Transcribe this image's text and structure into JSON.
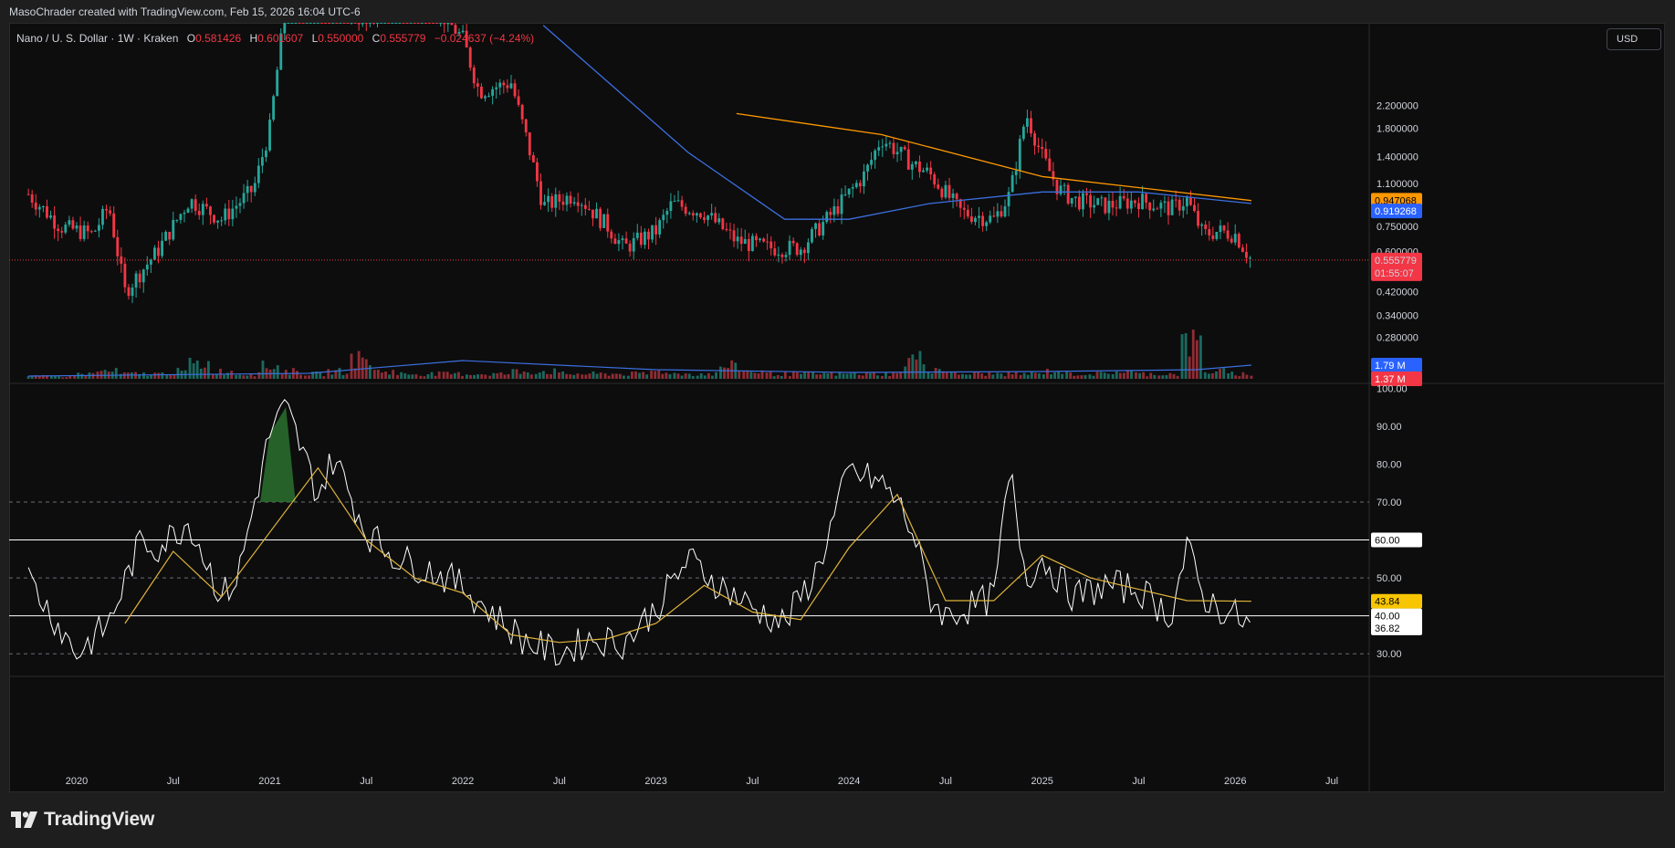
{
  "credit": "MasoChrader created with TradingView.com, Feb 15, 2026 16:04 UTC-6",
  "header": {
    "symbol": "Nano / U. S. Dollar · 1W · Kraken",
    "o_label": "O",
    "o_value": "0.581426",
    "h_label": "H",
    "h_value": "0.601607",
    "l_label": "L",
    "l_value": "0.550000",
    "c_label": "C",
    "c_value": "0.555779",
    "change": "−0.024637 (−4.24%)"
  },
  "currency_button": "USD",
  "brand": "TradingView",
  "colors": {
    "up": "#26a69a",
    "down": "#f23645",
    "ma_fast": "#3b6fe0",
    "ma_slow": "#ff9800",
    "rsi": "#ffffff",
    "rsi_ma": "#e0b43b",
    "overbought_fill": "#2e7d32"
  },
  "chart_data": [
    {
      "type": "candlestick",
      "pane": "price",
      "yscale": "log",
      "price_ticks": [
        "2.200000",
        "1.800000",
        "1.400000",
        "1.100000",
        "0.750000",
        "0.600000",
        "0.420000",
        "0.340000",
        "0.280000"
      ],
      "time_ticks": [
        "2020",
        "Jul",
        "2021",
        "Jul",
        "2022",
        "Jul",
        "2023",
        "Jul",
        "2024",
        "Jul",
        "2025",
        "Jul",
        "2026",
        "Jul"
      ],
      "labels": {
        "ma_slow_value": "0.947068",
        "ma_fast_value": "0.919268",
        "last_price": "0.555779",
        "countdown": "01:55:07",
        "volume_ma": "1.79 M",
        "volume_last": "1.37 M"
      },
      "ma_slow_line": {
        "x": [
          "2023-06",
          "2024-03",
          "2025-01",
          "2026-02"
        ],
        "y": [
          2.05,
          1.7,
          1.17,
          0.945
        ]
      },
      "ma_fast_line": {
        "x": [
          "2022-06",
          "2023-03",
          "2023-09",
          "2024-01",
          "2024-06",
          "2025-01",
          "2025-07",
          "2026-02"
        ],
        "y": [
          4.5,
          1.45,
          0.8,
          0.8,
          0.92,
          1.02,
          1.02,
          0.92
        ]
      },
      "close_anchors": {
        "x": [
          "2019-10",
          "2019-12",
          "2020-02",
          "2020-03",
          "2020-04",
          "2020-06",
          "2020-08",
          "2020-10",
          "2020-12",
          "2021-01",
          "2021-02",
          "2021-04",
          "2021-05",
          "2021-07",
          "2021-09",
          "2021-11",
          "2022-01",
          "2022-02",
          "2022-04",
          "2022-05",
          "2022-06",
          "2022-08",
          "2022-10",
          "2022-11",
          "2023-01",
          "2023-02",
          "2023-04",
          "2023-06",
          "2023-08",
          "2023-10",
          "2023-12",
          "2024-02",
          "2024-03",
          "2024-05",
          "2024-06",
          "2024-08",
          "2024-10",
          "2024-11",
          "2024-12",
          "2025-01",
          "2025-02",
          "2025-03",
          "2025-05",
          "2025-07",
          "2025-09",
          "2025-10",
          "2025-11",
          "2025-12",
          "2026-01",
          "2026-02"
        ],
        "y": [
          1.0,
          0.75,
          0.7,
          0.9,
          0.42,
          0.6,
          0.95,
          0.8,
          1.05,
          1.8,
          5.5,
          7.5,
          6.0,
          4.5,
          6.5,
          5.5,
          4.0,
          2.5,
          2.7,
          1.6,
          0.9,
          1.0,
          0.75,
          0.62,
          0.72,
          0.92,
          0.85,
          0.66,
          0.62,
          0.62,
          0.85,
          1.2,
          1.65,
          1.3,
          1.2,
          0.85,
          0.8,
          1.0,
          2.05,
          1.4,
          1.05,
          0.95,
          0.9,
          0.95,
          0.88,
          0.95,
          0.7,
          0.72,
          0.7,
          0.556
        ]
      }
    },
    {
      "type": "bar",
      "pane": "volume",
      "series": [
        {
          "values_relative": [
            1,
            1,
            2,
            3,
            2,
            2,
            3,
            6,
            3,
            2,
            5,
            3,
            2,
            3,
            8,
            3,
            2,
            2,
            2,
            2,
            2,
            3,
            3,
            2,
            2,
            2,
            2,
            3,
            2,
            2,
            5,
            3,
            2,
            2,
            2,
            2,
            2,
            2,
            8,
            4,
            2,
            2,
            2,
            2,
            3,
            2,
            2,
            3,
            2,
            2,
            14,
            3,
            2,
            2
          ]
        }
      ]
    },
    {
      "type": "line",
      "pane": "rsi",
      "y_ticks": [
        "100.00",
        "90.00",
        "80.00",
        "70.00",
        "50.00",
        "30.00"
      ],
      "ylim": [
        25,
        100
      ],
      "levels": [
        60,
        40
      ],
      "dashed_levels": [
        70,
        50,
        30
      ],
      "level_labels": [
        "60.00",
        "40.00"
      ],
      "value_labels": [
        "43.84",
        "36.82"
      ],
      "series": [
        {
          "name": "RSI",
          "x": [
            "2019-10",
            "2020-01",
            "2020-03",
            "2020-05",
            "2020-06",
            "2020-08",
            "2020-10",
            "2020-11",
            "2021-01",
            "2021-02",
            "2021-04",
            "2021-05",
            "2021-07",
            "2021-09",
            "2021-11",
            "2022-01",
            "2022-03",
            "2022-05",
            "2022-07",
            "2022-09",
            "2022-11",
            "2023-01",
            "2023-03",
            "2023-05",
            "2023-07",
            "2023-09",
            "2023-11",
            "2024-01",
            "2024-03",
            "2024-04",
            "2024-05",
            "2024-06",
            "2024-07",
            "2024-09",
            "2024-10",
            "2024-11",
            "2024-12",
            "2025-01",
            "2025-03",
            "2025-05",
            "2025-07",
            "2025-09",
            "2025-10",
            "2025-11",
            "2025-12",
            "2026-01",
            "2026-02"
          ],
          "y": [
            50,
            30,
            38,
            60,
            58,
            65,
            45,
            50,
            88,
            95,
            72,
            82,
            62,
            55,
            52,
            48,
            40,
            33,
            30,
            34,
            33,
            42,
            55,
            48,
            42,
            38,
            52,
            78,
            75,
            70,
            62,
            45,
            40,
            43,
            45,
            78,
            50,
            55,
            45,
            48,
            47,
            40,
            58,
            45,
            42,
            40,
            36.82
          ]
        },
        {
          "name": "RSI-based MA",
          "x": [
            "2020-04",
            "2020-07",
            "2020-10",
            "2021-01",
            "2021-04",
            "2021-07",
            "2021-10",
            "2022-01",
            "2022-04",
            "2022-07",
            "2022-10",
            "2023-01",
            "2023-04",
            "2023-07",
            "2023-10",
            "2024-01",
            "2024-04",
            "2024-07",
            "2024-10",
            "2025-01",
            "2025-04",
            "2025-07",
            "2025-10",
            "2026-02"
          ],
          "y": [
            38,
            57,
            45,
            62,
            79,
            60,
            50,
            46,
            35,
            33,
            34,
            38,
            48,
            41,
            39,
            58,
            72,
            44,
            44,
            56,
            50,
            47,
            44,
            43.84
          ]
        }
      ]
    }
  ]
}
